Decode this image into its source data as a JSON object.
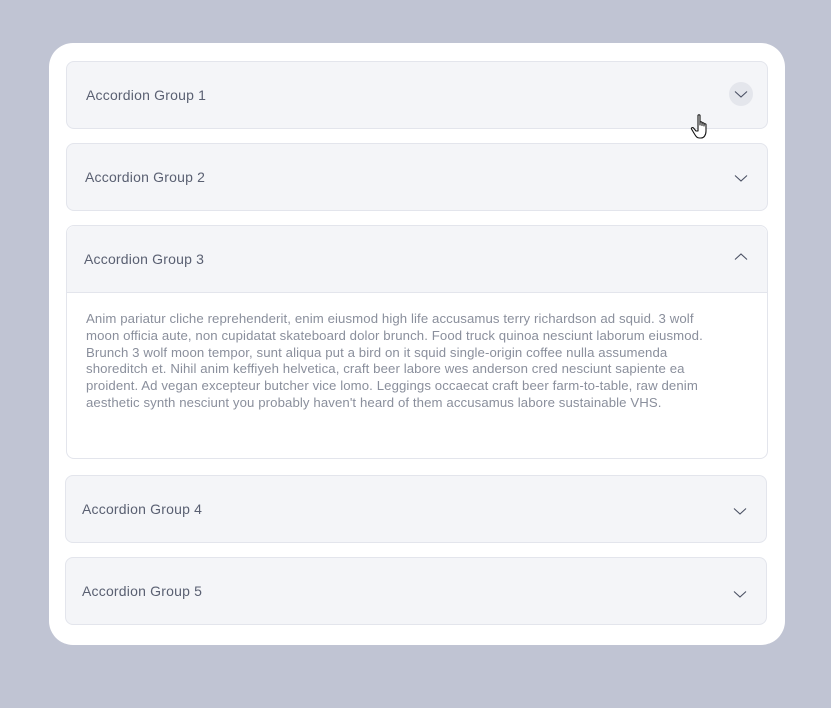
{
  "groups": [
    {
      "title": "Accordion Group 1",
      "expanded": false,
      "chevron": "chevron-down-icon"
    },
    {
      "title": "Accordion Group 2",
      "expanded": false,
      "chevron": "chevron-down-icon"
    },
    {
      "title": "Accordion Group 3",
      "expanded": true,
      "chevron": "chevron-up-icon",
      "content": "Anim pariatur cliche reprehenderit, enim eiusmod high life accusamus terry richardson ad squid. 3 wolf moon officia aute, non cupidatat skateboard dolor brunch. Food truck quinoa nesciunt laborum eiusmod. Brunch 3 wolf moon tempor, sunt aliqua put a bird on it squid single-origin coffee nulla assumenda shoreditch et. Nihil anim keffiyeh helvetica, craft beer labore wes anderson cred nesciunt sapiente ea proident. Ad vegan excepteur butcher vice lomo. Leggings occaecat craft beer farm-to-table, raw denim aesthetic synth nesciunt you probably haven't heard of them accusamus labore sustainable VHS."
    },
    {
      "title": "Accordion Group 4",
      "expanded": false,
      "chevron": "chevron-down-icon"
    },
    {
      "title": "Accordion Group 5",
      "expanded": false,
      "chevron": "chevron-down-icon"
    }
  ],
  "colors": {
    "background": "#c0c4d3",
    "card": "#ffffff",
    "header": "#f4f5f8",
    "border": "#e3e5ec",
    "title": "#5a6072",
    "body_text": "#8a8f9c"
  }
}
